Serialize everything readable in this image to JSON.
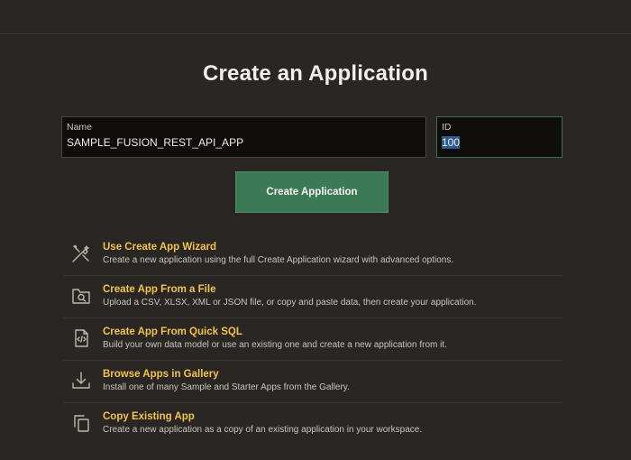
{
  "page": {
    "title": "Create an Application"
  },
  "form": {
    "name_label": "Name",
    "name_value": "SAMPLE_FUSION_REST_API_APP",
    "id_label": "ID",
    "id_value": "100",
    "create_button_label": "Create Application"
  },
  "options": [
    {
      "icon": "wizard-icon",
      "title": "Use Create App Wizard",
      "description": "Create a new application using the full Create Application wizard with advanced options."
    },
    {
      "icon": "file-search-icon",
      "title": "Create App From a File",
      "description": "Upload a CSV, XLSX, XML or JSON file, or copy and paste data, then create your application."
    },
    {
      "icon": "code-file-icon",
      "title": "Create App From Quick SQL",
      "description": "Build your own data model or use an existing one and create a new application from it."
    },
    {
      "icon": "download-icon",
      "title": "Browse Apps in Gallery",
      "description": "Install one of many Sample and Starter Apps from the Gallery."
    },
    {
      "icon": "copy-icon",
      "title": "Copy Existing App",
      "description": "Create a new application as a copy of an existing application in your workspace."
    }
  ],
  "colors": {
    "background": "#2a2623",
    "accent_green": "#3c7a56",
    "option_title": "#f2c34e",
    "field_background": "#0f0e0d"
  }
}
